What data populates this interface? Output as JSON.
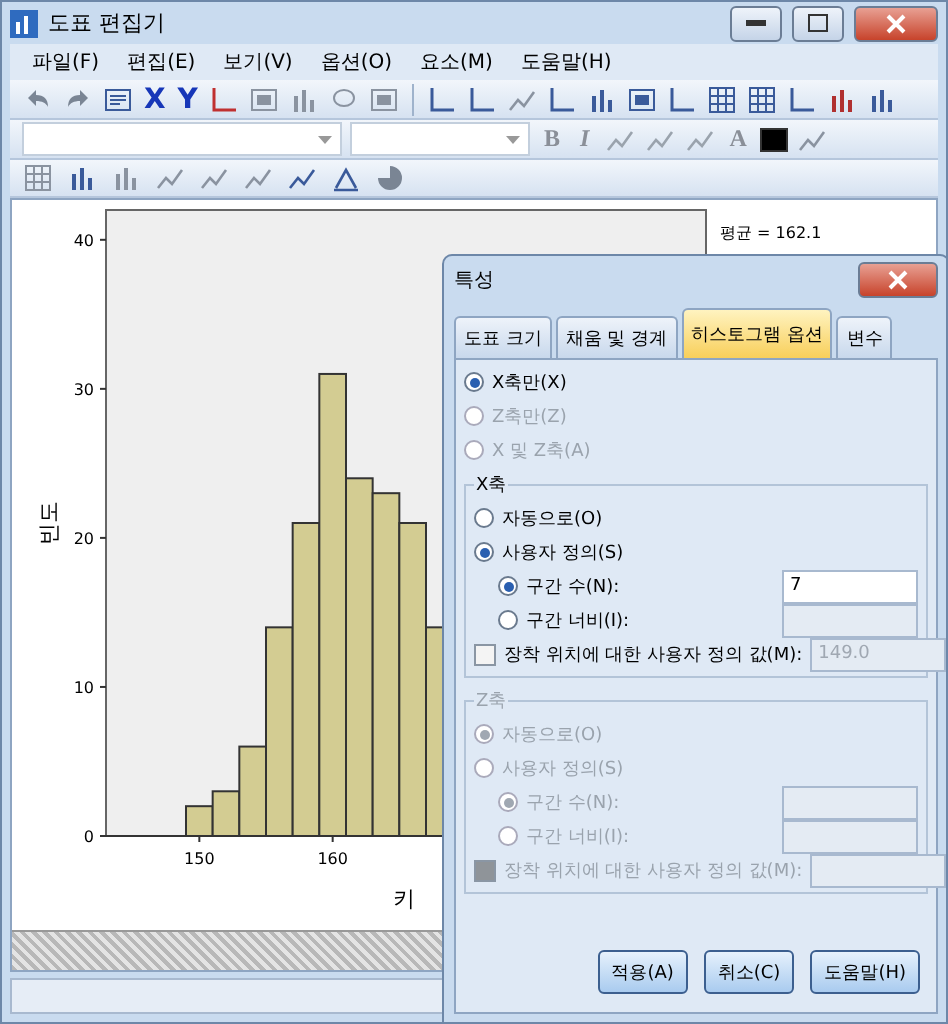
{
  "window": {
    "title": "도표 편집기"
  },
  "menu": [
    "파일(F)",
    "편집(E)",
    "보기(V)",
    "옵션(O)",
    "요소(M)",
    "도움말(H)"
  ],
  "toolbar": {
    "axis_buttons": [
      "X",
      "Y"
    ]
  },
  "format_bar": {
    "text_buttons": [
      "B",
      "I"
    ],
    "font_color_button": "A"
  },
  "chart": {
    "stat": "평균 = 162.1",
    "chart_data": {
      "type": "bar",
      "xlabel": "키",
      "ylabel": "빈도",
      "x": [
        150,
        152,
        154,
        156,
        158,
        160,
        162,
        164,
        166,
        168
      ],
      "values": [
        2,
        3,
        6,
        14,
        21,
        31,
        24,
        23,
        21,
        14
      ],
      "xlim": [
        143,
        188
      ],
      "ylim": [
        0,
        42
      ],
      "yticks": [
        {
          "value": 0,
          "label": "0"
        },
        {
          "value": 10,
          "label": "10"
        },
        {
          "value": 20,
          "label": "20"
        },
        {
          "value": 30,
          "label": "30"
        },
        {
          "value": 40,
          "label": "40"
        }
      ],
      "xticks": [
        {
          "value": 150,
          "label": "150"
        },
        {
          "value": 160,
          "label": "160"
        }
      ]
    }
  },
  "dialog": {
    "title": "특성",
    "tabs": [
      {
        "label": "도표 크기",
        "selected": false
      },
      {
        "label": "채움 및 경계",
        "selected": false
      },
      {
        "label": "히스토그램 옵션",
        "selected": true
      },
      {
        "label": "변수",
        "selected": false
      }
    ],
    "display": [
      {
        "label": "X축만(X)",
        "selected": true,
        "disabled": false
      },
      {
        "label": "Z축만(Z)",
        "selected": false,
        "disabled": true
      },
      {
        "label": "X 및 Z축(A)",
        "selected": false,
        "disabled": true
      }
    ],
    "axes": [
      {
        "title": "X축",
        "disabled": false,
        "options": [
          {
            "label": "자동으로(O)",
            "selected": false
          },
          {
            "label": "사용자 정의(S)",
            "selected": true
          }
        ],
        "sub_options": [
          {
            "label": "구간 수(N):",
            "selected": true,
            "value": "7"
          },
          {
            "label": "구간 너비(I):",
            "selected": false
          }
        ],
        "anchor": {
          "label": "장착 위치에 대한 사용자 정의 값(M):",
          "checked": false,
          "value": "149.0"
        }
      },
      {
        "title": "Z축",
        "disabled": true,
        "options": [
          {
            "label": "자동으로(O)",
            "selected": true
          },
          {
            "label": "사용자 정의(S)",
            "selected": false
          }
        ],
        "sub_options": [
          {
            "label": "구간 수(N):",
            "selected": true
          },
          {
            "label": "구간 너비(I):",
            "selected": false
          }
        ],
        "anchor": {
          "label": "장착 위치에 대한 사용자 정의 값(M):",
          "checked": false
        }
      }
    ],
    "buttons": [
      "적용(A)",
      "취소(C)",
      "도움말(H)"
    ]
  }
}
